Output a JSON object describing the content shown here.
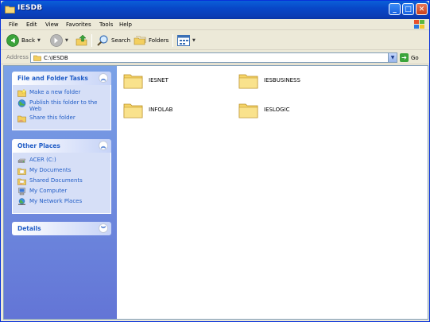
{
  "window": {
    "title": "IESDB"
  },
  "menu": [
    "File",
    "Edit",
    "View",
    "Favorites",
    "Tools",
    "Help"
  ],
  "toolbar": {
    "back": "Back",
    "search": "Search",
    "folders": "Folders"
  },
  "address": {
    "label": "Address",
    "path": "C:\\IESDB",
    "go": "Go"
  },
  "tasks_panel": {
    "title": "File and Folder Tasks",
    "items": [
      {
        "label": "Make a new folder",
        "icon": "new-folder-icon"
      },
      {
        "label": "Publish this folder to the Web",
        "icon": "publish-web-icon"
      },
      {
        "label": "Share this folder",
        "icon": "share-folder-icon"
      }
    ]
  },
  "places_panel": {
    "title": "Other Places",
    "items": [
      {
        "label": "ACER (C:)",
        "icon": "drive-icon"
      },
      {
        "label": "My Documents",
        "icon": "my-documents-icon"
      },
      {
        "label": "Shared Documents",
        "icon": "shared-documents-icon"
      },
      {
        "label": "My Computer",
        "icon": "my-computer-icon"
      },
      {
        "label": "My Network Places",
        "icon": "network-places-icon"
      }
    ]
  },
  "details_panel": {
    "title": "Details"
  },
  "folders": [
    "IESNET",
    "IESBUSINESS",
    "INFOLAB",
    "IESLOGIC"
  ],
  "colors": {
    "titlebar": "#0a5fd8",
    "taskpane": "#7ba2e7",
    "link": "#215dc6",
    "folder": "#f5d468"
  }
}
